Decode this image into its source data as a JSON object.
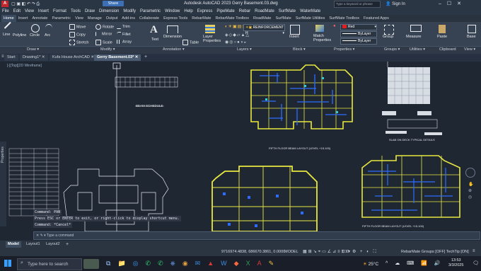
{
  "app": {
    "title": "Autodesk AutoCAD 2023    Gerry Basement.03.dwg",
    "search_placeholder": "Type a keyword or phrase",
    "sign_in": "Sign In",
    "share": "Share"
  },
  "menu": [
    "File",
    "Edit",
    "View",
    "Insert",
    "Format",
    "Tools",
    "Draw",
    "Dimension",
    "Modify",
    "Parametric",
    "Window",
    "Help",
    "Express",
    "PipeMate",
    "Rebar",
    "RoadMate",
    "SurfMate",
    "WaterMate"
  ],
  "ribbon_tabs": [
    "Home",
    "Insert",
    "Annotate",
    "Parametric",
    "View",
    "Manage",
    "Output",
    "Add-ins",
    "Collaborate",
    "Express Tools",
    "RebarMate",
    "RebarMate Toolbox",
    "RoadMate",
    "SurfMate",
    "SurfMate Utilities",
    "SurfMate Toolbox",
    "Featured Apps"
  ],
  "ribbon": {
    "draw": [
      "Line",
      "Polyline",
      "Circle",
      "Arc"
    ],
    "modify": [
      "Move",
      "Rotate",
      "Trim",
      "Copy",
      "Mirror",
      "Fillet",
      "Stretch",
      "Scale",
      "Array"
    ],
    "annotation": [
      "Text",
      "Dimension",
      "Table"
    ],
    "layers": {
      "btn": "Layer Properties",
      "current": "REINFORCEMENT H"
    },
    "block": "Insert",
    "properties": {
      "match": "Match Properties",
      "color": "Red",
      "lt1": "ByLayer",
      "lt2": "ByLayer"
    },
    "groups": "Group",
    "utilities": "Measure",
    "clipboard": "Paste",
    "view": "Base"
  },
  "panels": [
    "Draw",
    "Modify",
    "Annotation",
    "Layers",
    "Block",
    "Properties",
    "Groups",
    "Utilities",
    "Clipboard",
    "View"
  ],
  "doc_tabs": [
    "Start",
    "Drawing1*",
    "Kufa House ArchCAD",
    "Gerry Basement.03*"
  ],
  "viewport_label": "[-][Top][2D Wireframe]",
  "drawing_labels": {
    "beam_schedule": "BEAM SCHEDULE",
    "fifth_floor": "FIFTH FLOOR BEAM LAYOUT (LEVEL +15.100)",
    "slab": "SLAB ON DECK TYPICAL DETAILS",
    "fifth_floor_2": "FIFTH FLOOR BEAM LAYOUT (LEVEL +15.100)"
  },
  "properties_label": "Properties",
  "command": {
    "lines": [
      "Command: PAN",
      "Press ESC or ENTER to exit, or right-click to display shortcut menu.",
      "Command: *Cancel*"
    ],
    "placeholder": "Type a command"
  },
  "layout_tabs": [
    "Model",
    "Layout1",
    "Layout2"
  ],
  "status": {
    "coords": "9716974.4838, 686670.3861, 0.0000",
    "mode": "MODEL",
    "scale": "1:1",
    "rebar": "RebarMate Groups [OFF]  TechTip [ON]"
  },
  "taskbar": {
    "search": "Type here to search",
    "temp": "25°C",
    "time": "13:53",
    "date": "3/3/2025"
  },
  "colors": {
    "accent": "#3a8fe0",
    "layer_yellow": "#e8e840",
    "beam_blue": "#2e6bff",
    "bg": "#1f2733"
  }
}
